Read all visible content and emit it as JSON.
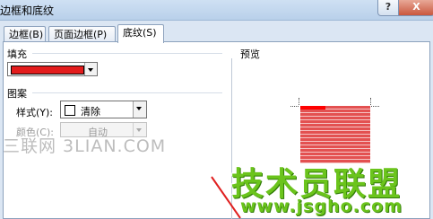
{
  "window": {
    "title": "边框和底纹"
  },
  "titlebar": {
    "help_label": "?",
    "close_label": "X"
  },
  "tabs": [
    {
      "label": "边框(B)"
    },
    {
      "label": "页面边框(P)"
    },
    {
      "label": "底纹(S)"
    }
  ],
  "fill": {
    "label": "填充",
    "color": "#e31c1c"
  },
  "pattern": {
    "label": "图案",
    "style_label": "样式(Y):",
    "style_value": "清除",
    "color_label": "颜色(C):",
    "color_value": "自动"
  },
  "preview": {
    "label": "预览",
    "colors": {
      "stripe": "#e35151",
      "light": "#f6c4c4",
      "top_bar": "#ff0000"
    }
  },
  "watermarks": {
    "left_text": "三联网 3LIAN.COM",
    "logo_text": "技术员联盟",
    "url_text": "www.jsgho.com"
  }
}
